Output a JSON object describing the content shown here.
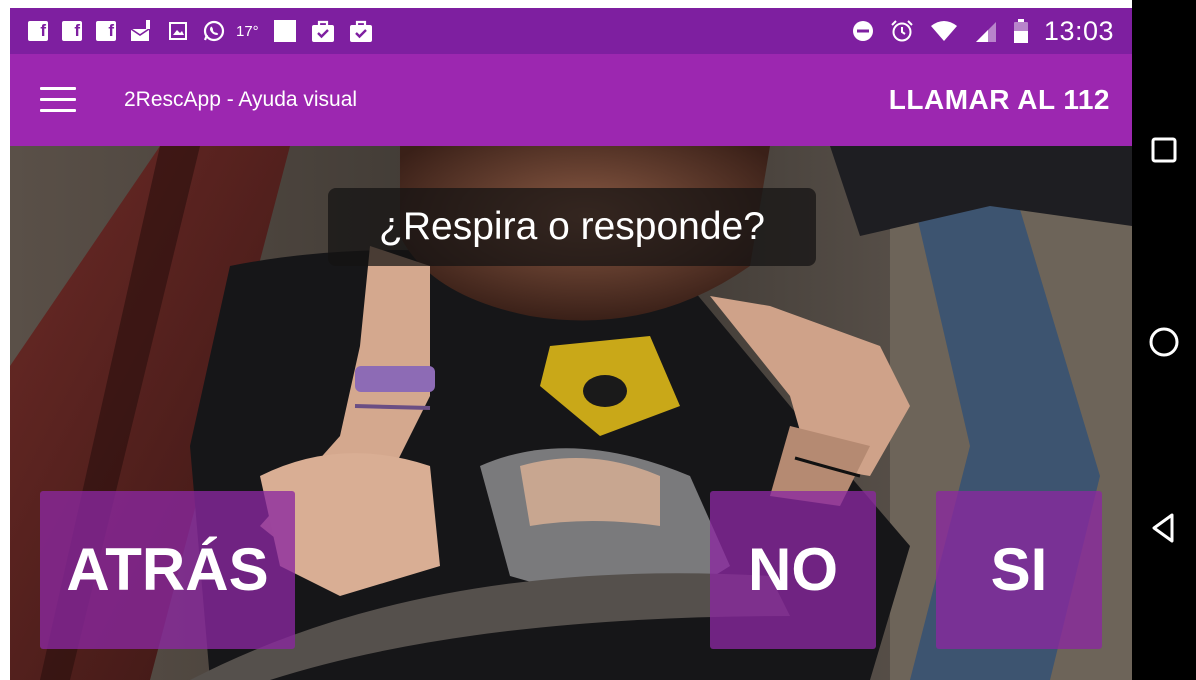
{
  "status_bar": {
    "notifications": [
      "facebook-icon",
      "facebook-icon",
      "facebook-icon",
      "mail-alert-icon",
      "image-icon",
      "whatsapp-icon",
      "temperature",
      "square-icon",
      "briefcase-check-icon",
      "briefcase-check-icon"
    ],
    "temperature": "17°",
    "fb_glyph": "f",
    "time": "13:03"
  },
  "app_bar": {
    "title": "2RescApp - Ayuda visual",
    "call_label": "LLAMAR AL 112"
  },
  "scene": {
    "question": "¿Respira o responde?",
    "back_label": "ATRÁS",
    "no_label": "NO",
    "yes_label": "SI"
  },
  "nav_bar": {
    "buttons": [
      "recents-icon",
      "home-icon",
      "back-icon"
    ]
  },
  "colors": {
    "status_bar": "#7e1fa0",
    "app_bar": "#9c27b0",
    "button_overlay": "#8a28a0"
  }
}
